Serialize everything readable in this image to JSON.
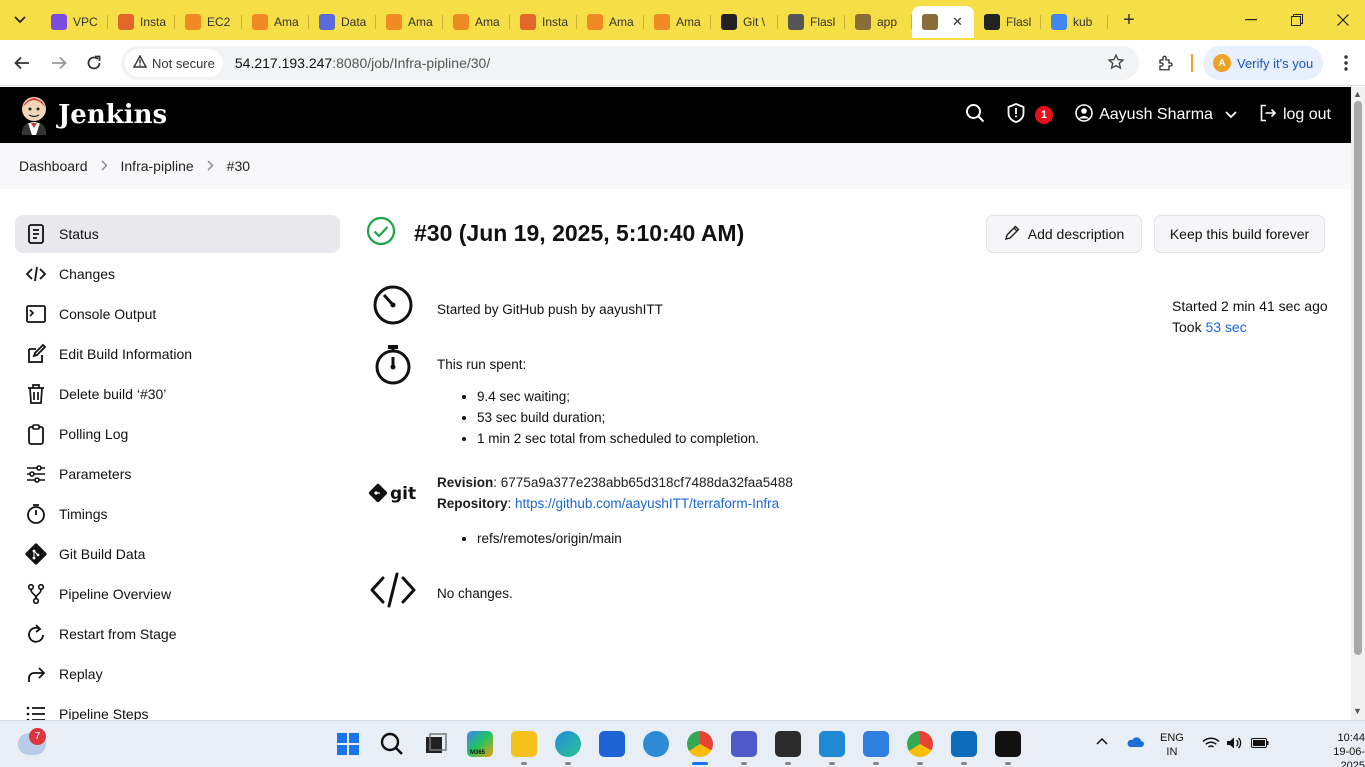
{
  "browser": {
    "tabs": [
      {
        "title": "VPC",
        "color": "#7b4ce0"
      },
      {
        "title": "Insta",
        "color": "#e0662a"
      },
      {
        "title": "EC2",
        "color": "#f08a24"
      },
      {
        "title": "Ama",
        "color": "#f08a24"
      },
      {
        "title": "Data",
        "color": "#5a6bd8"
      },
      {
        "title": "Ama",
        "color": "#f08a24"
      },
      {
        "title": "Ama",
        "color": "#f08a24"
      },
      {
        "title": "Insta",
        "color": "#e0662a"
      },
      {
        "title": "Ama",
        "color": "#f08a24"
      },
      {
        "title": "Ama",
        "color": "#f08a24"
      },
      {
        "title": "Git \\",
        "color": "#222222"
      },
      {
        "title": "Flasl",
        "color": "#555555"
      },
      {
        "title": "app",
        "color": "#8a6d3b"
      },
      {
        "title": "",
        "color": "#8a6d3b",
        "active": true
      },
      {
        "title": "Flasl",
        "color": "#222222"
      },
      {
        "title": "kub",
        "color": "#4285f4"
      }
    ],
    "close_tab": "✕",
    "new_tab": "+",
    "not_secure": "Not secure",
    "url_host": "54.217.193.247",
    "url_path": ":8080/job/Infra-pipline/30/",
    "verify": "Verify it's you",
    "verify_avatar": "A"
  },
  "header": {
    "brand": "Jenkins",
    "alert_count": "1",
    "user": "Aayush Sharma",
    "logout": "log out"
  },
  "breadcrumb": [
    "Dashboard",
    "Infra-pipline",
    "#30"
  ],
  "sidebar": [
    {
      "label": "Status",
      "icon": "status-icon",
      "active": true
    },
    {
      "label": "Changes",
      "icon": "code-icon"
    },
    {
      "label": "Console Output",
      "icon": "terminal-icon"
    },
    {
      "label": "Edit Build Information",
      "icon": "edit-icon"
    },
    {
      "label": "Delete build ‘#30’",
      "icon": "trash-icon"
    },
    {
      "label": "Polling Log",
      "icon": "clipboard-icon"
    },
    {
      "label": "Parameters",
      "icon": "sliders-icon"
    },
    {
      "label": "Timings",
      "icon": "stopwatch-icon"
    },
    {
      "label": "Git Build Data",
      "icon": "git-icon"
    },
    {
      "label": "Pipeline Overview",
      "icon": "pipeline-icon"
    },
    {
      "label": "Restart from Stage",
      "icon": "restart-icon"
    },
    {
      "label": "Replay",
      "icon": "replay-icon"
    },
    {
      "label": "Pipeline Steps",
      "icon": "list-icon"
    }
  ],
  "build": {
    "title": "#30 (Jun 19, 2025, 5:10:40 AM)",
    "add_description": "Add description",
    "keep_forever": "Keep this build forever",
    "started_by": "Started by GitHub push by aayushITT",
    "started_ago": "Started 2 min 41 sec ago",
    "took_label": "Took",
    "took_value": "53 sec",
    "run_spent": "This run spent:",
    "run_items": [
      "9.4 sec waiting;",
      "53 sec build duration;",
      "1 min 2 sec total from scheduled to completion."
    ],
    "git_label": "git",
    "revision_label": "Revision",
    "revision": ": 6775a9a377e238abb65d318cf7488da32faa5488",
    "repository_label": "Repository",
    "repository_sep": ": ",
    "repository_url": "https://github.com/aayushITT/terraform-Infra",
    "refs": [
      "refs/remotes/origin/main"
    ],
    "no_changes": "No changes."
  },
  "taskbar": {
    "widget_badge": "7",
    "m365_label": "M365",
    "lang_top": "ENG",
    "lang_bottom": "IN",
    "time": "10:44",
    "date": "19-06-2025"
  }
}
